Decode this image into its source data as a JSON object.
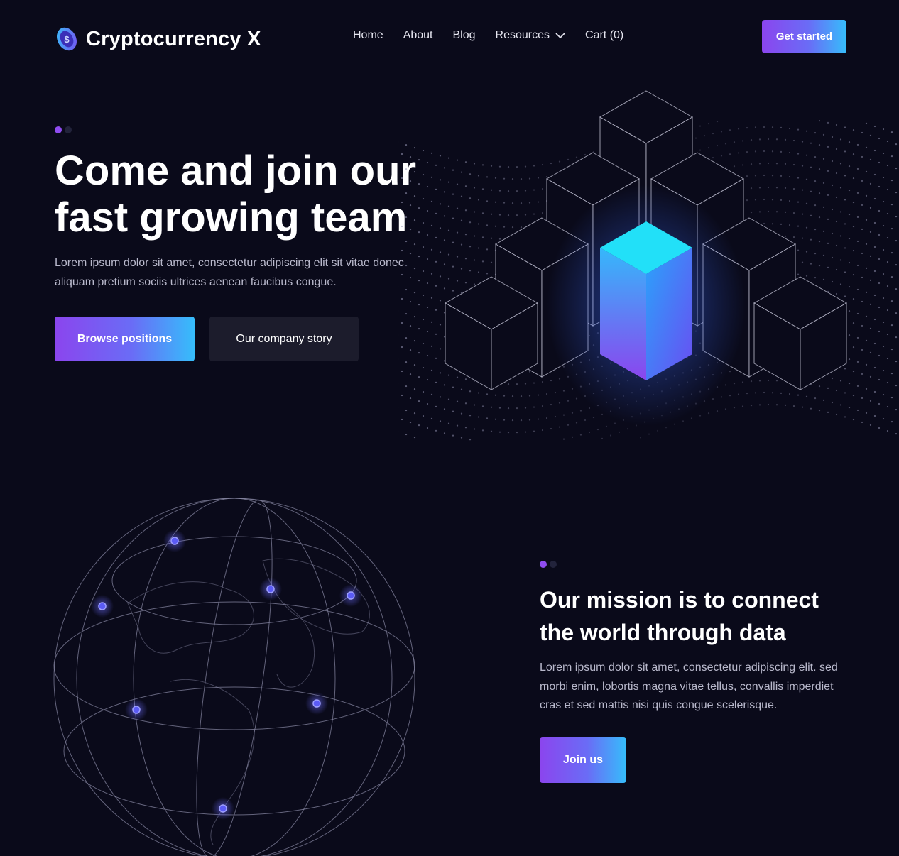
{
  "brand": {
    "name": "Cryptocurrency X",
    "logo_icon": "dollar-coin-icon"
  },
  "nav": {
    "items": [
      {
        "label": "Home"
      },
      {
        "label": "About"
      },
      {
        "label": "Blog"
      },
      {
        "label": "Resources",
        "icon": "chevron-down-icon"
      },
      {
        "label": "Cart (0)"
      }
    ],
    "cta_label": "Get started"
  },
  "hero": {
    "title": "Come and join our fast growing team",
    "description": "Lorem ipsum dolor sit amet, consectetur adipiscing elit sit vitae donec aliquam pretium sociis ultrices aenean faucibus congue.",
    "primary_button": "Browse positions",
    "secondary_button": "Our company story"
  },
  "mission": {
    "title": "Our mission is to connect the world through data",
    "description": "Lorem ipsum dolor sit amet, consectetur adipiscing elit. sed morbi enim, lobortis magna vitae tellus, convallis imperdiet cras et sed mattis nisi quis congue scelerisque.",
    "button": "Join us"
  },
  "colors": {
    "background": "#0a0a1a",
    "accent_purple": "#8b45ee",
    "accent_blue": "#36bdfb",
    "accent_cyan": "#22e0f8",
    "secondary_button": "#1c1c2c",
    "body_text": "#b9b9cc"
  }
}
